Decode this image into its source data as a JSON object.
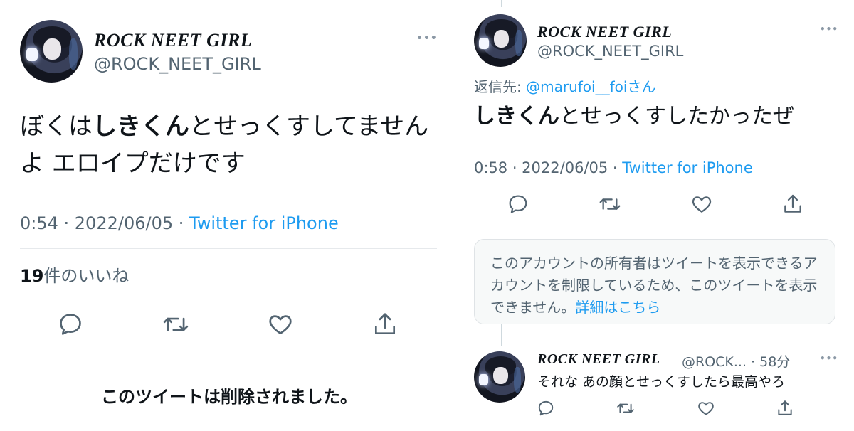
{
  "left": {
    "author": {
      "name": "ROCK NEET GIRL",
      "handle": "@ROCK_NEET_GIRL"
    },
    "more": "•••",
    "text": {
      "part1": "ぼくは",
      "bold": "しきくん",
      "part2": "とせっくすしてませんよ エロイプだけです"
    },
    "meta": {
      "time": "0:54 · 2022/06/05 · ",
      "source": "Twitter for iPhone"
    },
    "likes": {
      "count": "19",
      "label": "件のいいね"
    },
    "deleted": "このツイートは削除されました。"
  },
  "right": {
    "author": {
      "name": "ROCK NEET GIRL",
      "handle": "@ROCK_NEET_GIRL"
    },
    "more": "•••",
    "reply_to": {
      "prefix": "返信先: ",
      "handle": "@marufoi__foi",
      "suffix": "さん"
    },
    "text": {
      "bold": "しきくん",
      "rest": "とせっくすしたかったぜ"
    },
    "meta": {
      "time": "0:58 · 2022/06/05 · ",
      "source": "Twitter for iPhone"
    },
    "notice": {
      "text": "このアカウントの所有者はツイートを表示できるアカウントを制限しているため、このツイートを表示できません。",
      "link": "詳細はこちら"
    },
    "reply": {
      "name": "ROCK NEET GIRL",
      "handle": "@ROCK... · 58分",
      "more": "•••",
      "text": "それな あの顔とせっくすしたら最高やろ"
    }
  },
  "colors": {
    "link": "#1d9bf0",
    "secondary": "#536471",
    "icon": "#536471"
  }
}
